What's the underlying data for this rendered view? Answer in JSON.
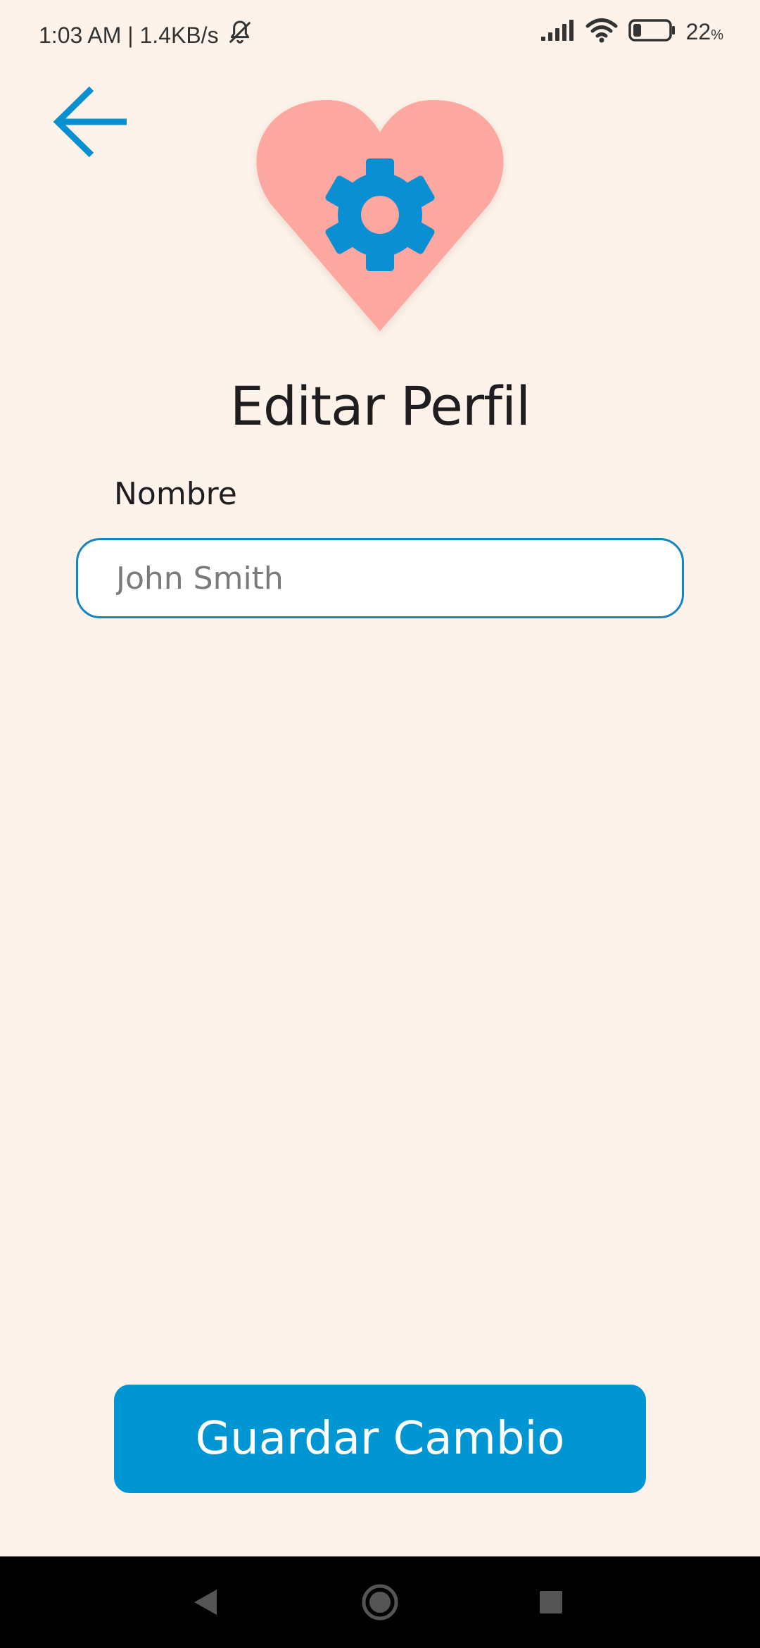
{
  "status_bar": {
    "time_and_speed": "1:03 AM | 1.4KB/s",
    "battery_percent": "22",
    "battery_unit": "%",
    "battery_level": 0.22
  },
  "header": {
    "back_icon": "arrow-left-icon",
    "hero_icon": "heart-gear-icon"
  },
  "page": {
    "title": "Editar Perfil"
  },
  "form": {
    "name_label": "Nombre",
    "name_value": "",
    "name_placeholder": "John Smith"
  },
  "actions": {
    "save_label": "Guardar Cambio"
  },
  "colors": {
    "background": "#fdf3ea",
    "accent": "#0096d3",
    "heart": "#fca7a0",
    "input_border": "#1386c0"
  }
}
